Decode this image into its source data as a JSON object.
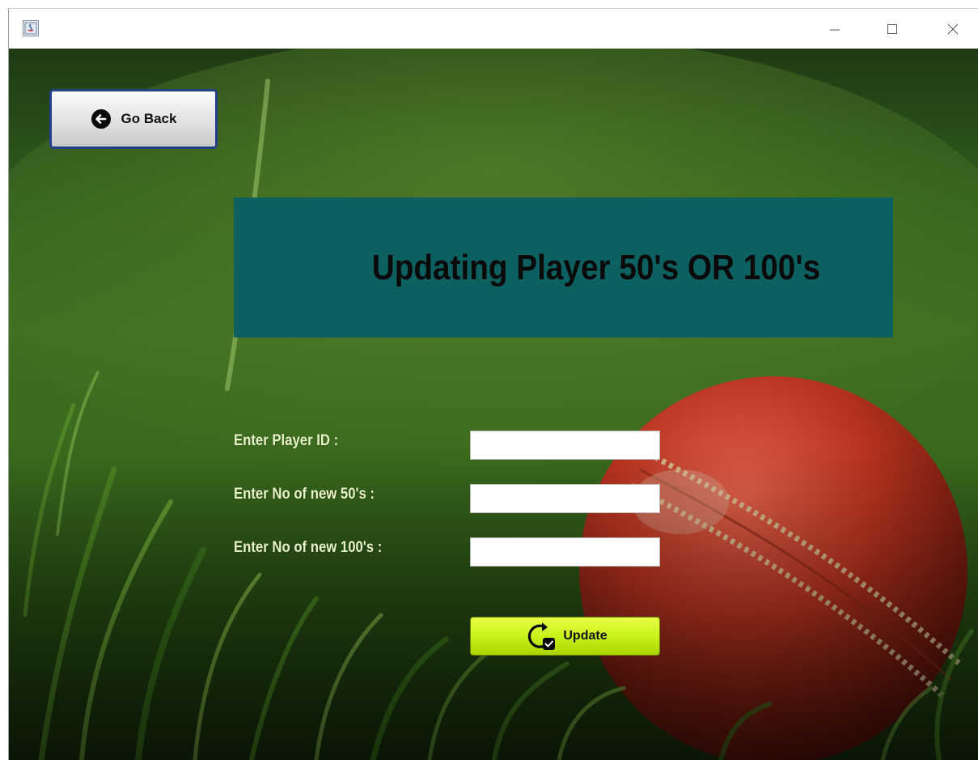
{
  "window": {
    "title": "",
    "controls": {
      "minimize_icon": "minimize-icon",
      "maximize_icon": "maximize-icon",
      "close_icon": "close-icon"
    }
  },
  "nav": {
    "back_label": "Go Back",
    "back_icon": "arrow-left-circle-icon"
  },
  "header": {
    "title": "Updating Player 50's OR 100's"
  },
  "form": {
    "fields": [
      {
        "label": "Enter Player ID :",
        "value": ""
      },
      {
        "label": "Enter No of new 50's :",
        "value": ""
      },
      {
        "label": "Enter No of new 100's :",
        "value": ""
      }
    ],
    "submit_label": "Update",
    "submit_icon": "refresh-check-icon"
  },
  "colors": {
    "title_panel": "#0d6060",
    "update_button": "#c9f21a",
    "back_button_border": "#23408a",
    "label_text": "#e8f4c8"
  }
}
